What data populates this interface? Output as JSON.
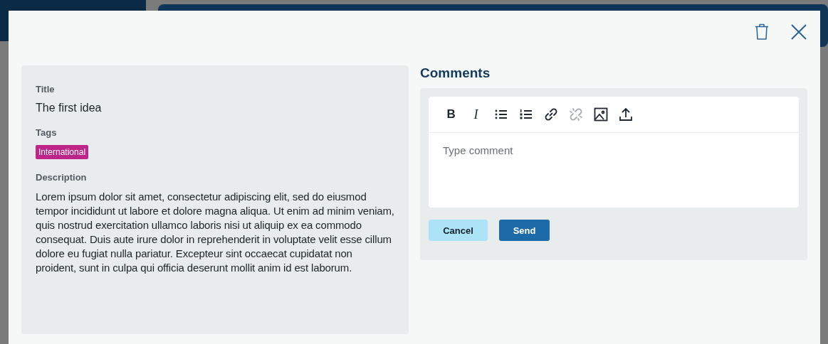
{
  "details": {
    "fields": [
      {
        "label": "Title",
        "kind": "text",
        "value": "The first idea"
      },
      {
        "label": "Tags",
        "kind": "tags",
        "tags": [
          {
            "text": "International",
            "color": "#be2588"
          }
        ]
      },
      {
        "label": "Description",
        "kind": "paragraph",
        "value": "Lorem ipsum dolor sit amet, consectetur adipiscing elit, sed do eiusmod tempor incididunt ut labore et dolore magna aliqua. Ut enim ad minim veniam, quis nostrud exercitation ullamco laboris nisi ut aliquip ex ea commodo consequat. Duis aute irure dolor in reprehenderit in voluptate velit esse cillum dolore eu fugiat nulla pariatur. Excepteur sint occaecat cupidatat non proident, sunt in culpa qui officia deserunt mollit anim id est laborum."
      }
    ]
  },
  "comments": {
    "heading": "Comments",
    "toolbar": [
      {
        "kind": "bold",
        "label": "B",
        "disabled": false
      },
      {
        "kind": "italic",
        "label": "I",
        "disabled": false
      },
      {
        "kind": "bullets",
        "disabled": false
      },
      {
        "kind": "numbers",
        "disabled": false
      },
      {
        "kind": "link",
        "disabled": false
      },
      {
        "kind": "unlink",
        "disabled": true
      },
      {
        "kind": "image",
        "disabled": false
      },
      {
        "kind": "upload",
        "disabled": false
      }
    ],
    "editor": {
      "placeholder": "Type comment"
    },
    "buttons": [
      {
        "label": "Cancel",
        "kind": "secondary"
      },
      {
        "label": "Send",
        "kind": "primary"
      }
    ]
  }
}
